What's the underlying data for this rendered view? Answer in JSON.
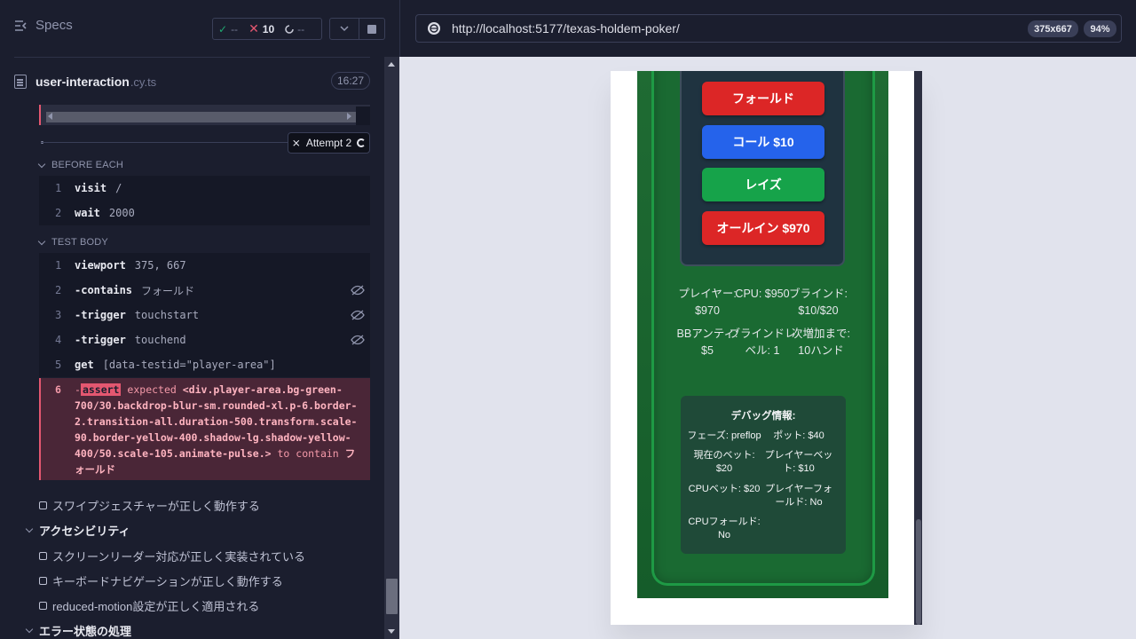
{
  "header": {
    "specs_label": "Specs",
    "stats": {
      "passed": "--",
      "failed": "10",
      "pending": "--"
    }
  },
  "spec": {
    "name": "user-interaction",
    "ext": ".cy.ts",
    "duration": "16:27"
  },
  "attempt_label": "Attempt 2",
  "before_each": {
    "title": "BEFORE EACH",
    "commands": [
      {
        "n": "1",
        "name": "visit",
        "arg": "/"
      },
      {
        "n": "2",
        "name": "wait",
        "arg": "2000"
      }
    ]
  },
  "test_body": {
    "title": "TEST BODY",
    "commands": [
      {
        "n": "1",
        "name": "viewport",
        "arg": "375, 667"
      },
      {
        "n": "2",
        "name": "-contains",
        "arg": "フォールド"
      },
      {
        "n": "3",
        "name": "-trigger",
        "arg": "touchstart"
      },
      {
        "n": "4",
        "name": "-trigger",
        "arg": "touchend"
      },
      {
        "n": "5",
        "name": "get",
        "arg": "[data-testid=\"player-area\"]"
      }
    ],
    "failed": {
      "n": "6",
      "name": "assert",
      "expected": "expected",
      "subject": "<div.player-area.bg-green-700/30.backdrop-blur-sm.rounded-xl.p-6.border-2.transition-all.duration-500.transform.scale-90.border-yellow-400.shadow-lg.shadow-yellow-400/50.scale-105.animate-pulse.>",
      "to_contain": "to contain",
      "value": "フォールド"
    }
  },
  "tests": [
    {
      "type": "test",
      "label": "スワイプジェスチャーが正しく動作する"
    },
    {
      "type": "suite",
      "label": "アクセシビリティ"
    },
    {
      "type": "test",
      "label": "スクリーンリーダー対応が正しく実装されている"
    },
    {
      "type": "test",
      "label": "キーボードナビゲーションが正しく動作する"
    },
    {
      "type": "test",
      "label": "reduced-motion設定が正しく適用される"
    },
    {
      "type": "suite",
      "label": "エラー状態の処理"
    }
  ],
  "aut": {
    "url": "http://localhost:5177/texas-holdem-poker/",
    "viewport": "375x667",
    "zoom": "94%"
  },
  "game": {
    "buttons": {
      "fold": "フォールド",
      "call": "コール $10",
      "raise": "レイズ",
      "allin": "オールイン $970"
    },
    "info": {
      "player": "プレイヤー: $970",
      "cpu": "CPU: $950",
      "blind": "ブラインド: $10/$20",
      "ante": "BBアンティ: $5",
      "level": "ブラインドレベル: 1",
      "next": "次増加まで: 10ハンド"
    },
    "debug": {
      "title": "デバッグ情報:",
      "phase": "フェーズ: preflop",
      "pot": "ポット: $40",
      "current_bet": "現在のベット: $20",
      "player_bet": "プレイヤーベット: $10",
      "cpu_bet": "CPUベット: $20",
      "player_fold": "プレイヤーフォールド: No",
      "cpu_fold": "CPUフォールド: No"
    }
  },
  "colors": {
    "fail": "#e45770",
    "pass": "#1fa971",
    "felt": "#1a6a32"
  }
}
